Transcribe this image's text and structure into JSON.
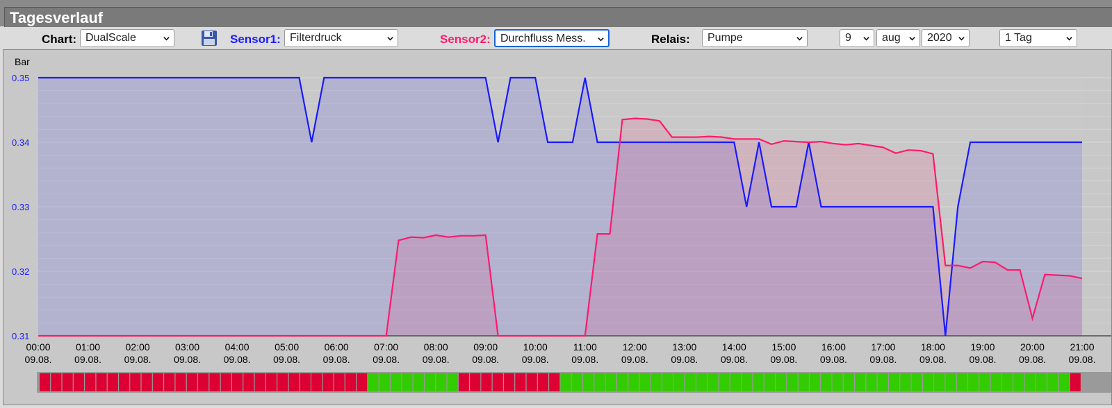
{
  "window": {
    "title": "Tagesverlauf"
  },
  "toolbar": {
    "chart_label": "Chart:",
    "chart_value": "DualScale",
    "save_icon": "floppy-disk-icon",
    "sensor1_label": "Sensor1:",
    "sensor1_value": "Filterdruck",
    "sensor2_label": "Sensor2:",
    "sensor2_value": "Durchfluss Mess.",
    "relais_label": "Relais:",
    "relais_value": "Pumpe",
    "day_value": "9",
    "month_value": "aug",
    "year_value": "2020",
    "range_value": "1 Tag"
  },
  "colors": {
    "sensor1": "#1a1aff",
    "sensor2": "#ff1a6e",
    "relay_on": "#33cc00",
    "relay_off": "#dd0033",
    "focus": "#1565d8"
  },
  "chart_data": {
    "type": "line",
    "ylabel": "Bar",
    "ylim": [
      0.31,
      0.35
    ],
    "yticks": [
      "0.35",
      "0.34",
      "0.33",
      "0.32",
      "0.31"
    ],
    "xlim": [
      0,
      21
    ],
    "xticks": [
      {
        "time": "00:00",
        "date": "09.08."
      },
      {
        "time": "01:00",
        "date": "09.08."
      },
      {
        "time": "02:00",
        "date": "09.08."
      },
      {
        "time": "03:00",
        "date": "09.08."
      },
      {
        "time": "04:00",
        "date": "09.08."
      },
      {
        "time": "05:00",
        "date": "09.08."
      },
      {
        "time": "06:00",
        "date": "09.08."
      },
      {
        "time": "07:00",
        "date": "09.08."
      },
      {
        "time": "08:00",
        "date": "09.08."
      },
      {
        "time": "09:00",
        "date": "09.08."
      },
      {
        "time": "10:00",
        "date": "09.08."
      },
      {
        "time": "11:00",
        "date": "09.08."
      },
      {
        "time": "12:00",
        "date": "09.08."
      },
      {
        "time": "13:00",
        "date": "09.08."
      },
      {
        "time": "14:00",
        "date": "09.08."
      },
      {
        "time": "15:00",
        "date": "09.08."
      },
      {
        "time": "16:00",
        "date": "09.08."
      },
      {
        "time": "17:00",
        "date": "09.08."
      },
      {
        "time": "18:00",
        "date": "09.08."
      },
      {
        "time": "19:00",
        "date": "09.08."
      },
      {
        "time": "20:00",
        "date": "09.08."
      },
      {
        "time": "21:00",
        "date": "09.08."
      }
    ],
    "series": [
      {
        "name": "Filterdruck",
        "color": "#1a1aff",
        "x": [
          0,
          5.25,
          5.5,
          5.75,
          9.0,
          9.25,
          9.5,
          10.0,
          10.25,
          10.75,
          11.0,
          11.25,
          14.0,
          14.25,
          14.5,
          14.75,
          15.25,
          15.5,
          15.75,
          18.0,
          18.25,
          18.5,
          18.75,
          21.0
        ],
        "y": [
          0.35,
          0.35,
          0.34,
          0.35,
          0.35,
          0.34,
          0.35,
          0.35,
          0.34,
          0.34,
          0.35,
          0.34,
          0.34,
          0.33,
          0.34,
          0.33,
          0.33,
          0.34,
          0.33,
          0.33,
          0.31,
          0.33,
          0.34,
          0.34
        ]
      },
      {
        "name": "Durchfluss Mess.",
        "color": "#ff1a6e",
        "x": [
          0,
          7.0,
          7.25,
          7.5,
          7.75,
          8.0,
          8.25,
          8.5,
          8.75,
          9.0,
          9.25,
          11.0,
          11.25,
          11.5,
          11.75,
          12.0,
          12.25,
          12.5,
          12.75,
          13.0,
          13.25,
          13.5,
          13.75,
          14.0,
          14.25,
          14.5,
          14.75,
          15.0,
          15.25,
          15.5,
          15.75,
          16.0,
          16.25,
          16.5,
          16.75,
          17.0,
          17.25,
          17.5,
          17.75,
          18.0,
          18.25,
          18.5,
          18.75,
          19.0,
          19.25,
          19.5,
          19.75,
          20.0,
          20.25,
          20.5,
          20.75,
          21.0
        ],
        "y": [
          0.31,
          0.31,
          0.3248,
          0.3253,
          0.3252,
          0.3256,
          0.3253,
          0.3255,
          0.3255,
          0.3256,
          0.31,
          0.31,
          0.3258,
          0.3258,
          0.3435,
          0.3437,
          0.3436,
          0.3433,
          0.3408,
          0.3408,
          0.3408,
          0.3409,
          0.3408,
          0.3405,
          0.3405,
          0.3405,
          0.3397,
          0.3402,
          0.3401,
          0.34,
          0.3401,
          0.3398,
          0.3396,
          0.3398,
          0.3395,
          0.3392,
          0.3383,
          0.3388,
          0.3387,
          0.3382,
          0.3209,
          0.3209,
          0.3205,
          0.3215,
          0.3214,
          0.3202,
          0.3202,
          0.3127,
          0.3195,
          0.3194,
          0.3193,
          0.3189
        ]
      }
    ],
    "relay": [
      0,
      0,
      0,
      0,
      0,
      0,
      0,
      0,
      0,
      0,
      0,
      0,
      0,
      0,
      0,
      0,
      0,
      0,
      0,
      0,
      0,
      0,
      0,
      0,
      0,
      0,
      0,
      0,
      0,
      1,
      1,
      1,
      1,
      1,
      1,
      1,
      1,
      0,
      0,
      0,
      0,
      0,
      0,
      0,
      0,
      0,
      1,
      1,
      1,
      1,
      1,
      1,
      1,
      1,
      1,
      1,
      1,
      1,
      1,
      1,
      1,
      1,
      1,
      1,
      1,
      1,
      1,
      1,
      1,
      1,
      1,
      1,
      1,
      1,
      1,
      1,
      1,
      1,
      1,
      1,
      1,
      1,
      1,
      1,
      1,
      1,
      1,
      1,
      1,
      1,
      1,
      0
    ],
    "grid": true
  }
}
